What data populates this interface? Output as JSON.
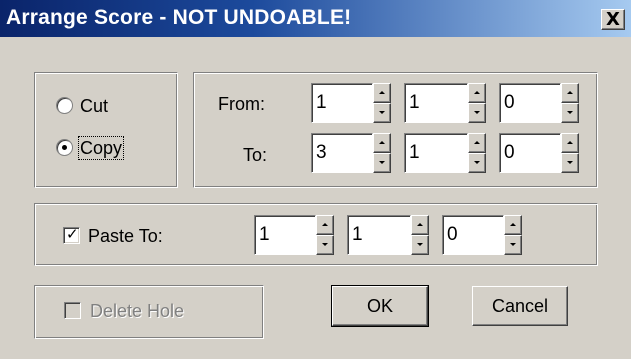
{
  "window": {
    "title": "Arrange Score - NOT UNDOABLE!",
    "close_label": "X"
  },
  "mode": {
    "cut_label": "Cut",
    "copy_label": "Copy",
    "selected": "Copy"
  },
  "range": {
    "from_label": "From:",
    "to_label": "To:",
    "from": [
      "1",
      "1",
      "0"
    ],
    "to": [
      "3",
      "1",
      "0"
    ]
  },
  "paste": {
    "label": "Paste To:",
    "checked": true,
    "values": [
      "1",
      "1",
      "0"
    ]
  },
  "delete_hole": {
    "label": "Delete Hole",
    "checked": false,
    "enabled": false
  },
  "buttons": {
    "ok": "OK",
    "cancel": "Cancel"
  }
}
